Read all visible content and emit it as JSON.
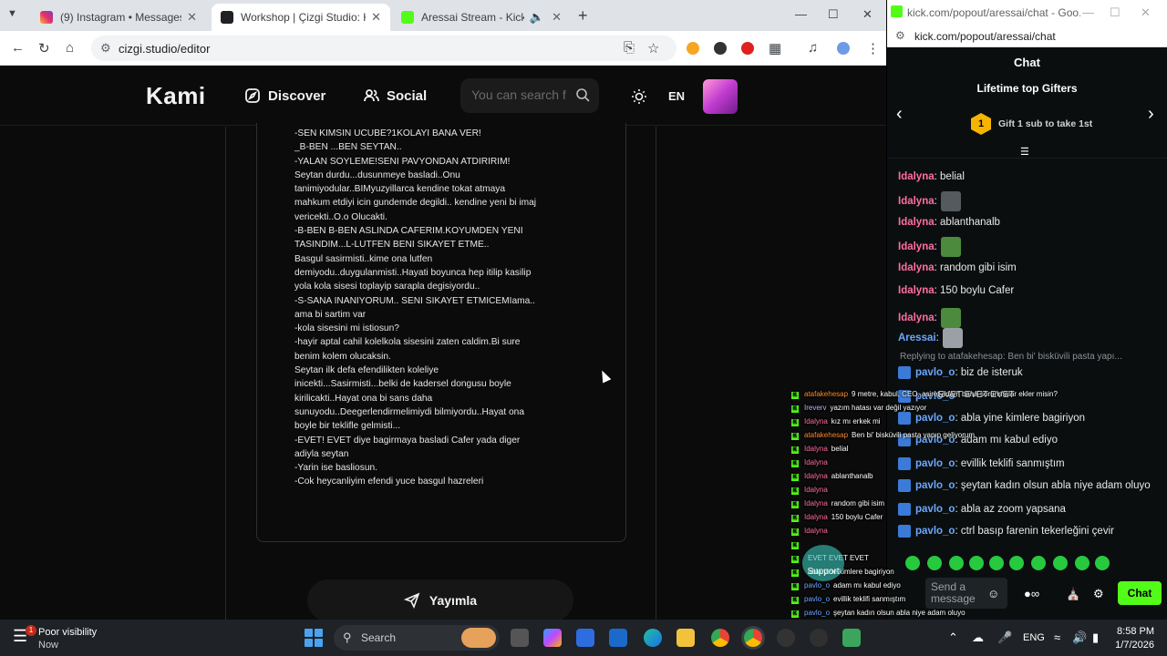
{
  "left_browser": {
    "tabs": [
      {
        "title": "(9) Instagram • Messages",
        "color": "#e1306c",
        "active": false
      },
      {
        "title": "Workshop | Çizgi Studio: Kami",
        "color": "#202124",
        "active": true
      },
      {
        "title": "Aressai Stream - Kick Dashb",
        "color": "#53fc18",
        "active": false
      }
    ],
    "url": "cizgi.studio/editor"
  },
  "site": {
    "logo": "Kami",
    "nav_discover": "Discover",
    "nav_social": "Social",
    "search_placeholder": "You can search f",
    "lang": "EN",
    "publish_label": "Yayımla",
    "story_lines": [
      "-SEN KIMSIN UCUBE?1KOLAYI BANA VER!",
      "_B-BEN ...BEN SEYTAN..",
      "-YALAN SOYLEME!SENI PAVYONDAN ATDIRIRIM!",
      "Seytan durdu...dusunmeye basladi..Onu",
      "tanimiyodular..BIMyuzyillarca kendine tokat atmaya",
      "mahkum etdiyi icin gundemde degildi.. kendine yeni bi imaj",
      "vericekti..O.o Olucakti.",
      "-B-BEN  B-BEN ASLINDA CAFERIM.KOYUMDEN YENI",
      "TASINDIM...L-LUTFEN BENI SIKAYET ETME..",
      "Basgul sasirmisti..kime ona lutfen",
      "demiyodu..duygulanmisti..Hayati boyunca hep itilip kasilip",
      "yola kola sisesi toplayip sarapla degisiyordu..",
      "-S-SANA INANIYORUM.. SENI SIKAYET ETMICEMIama..",
      "ama bi sartim var",
      "-kola sisesini mi istiosun?",
      "-hayir aptal cahil kolelkola sisesini zaten caldim.Bi sure",
      "benim kolem olucaksin.",
      "Seytan ilk defa efendilikten koleliye",
      "inicekti...Sasirmisti...belki de kadersel dongusu boyle",
      "kirilicakti..Hayat ona bi sans daha",
      "sunuyodu..Deegerlendirmelimiydi bilmiyordu..Hayat ona",
      "boyle bir teklifle gelmisti...",
      "-EVET! EVET diye bagirmaya basladi Cafer yada diger",
      "adiyla seytan",
      "-Yarin ise basliosun.",
      "-Cok heycanliyim efendi yuce basgul hazreleri"
    ]
  },
  "overlay_chat": [
    {
      "user": "atafakehesap",
      "color": "#ff8a2b",
      "text": "9 metre, kabul, CEO, asiret adam bana sorunmalar ekler misin?"
    },
    {
      "user": "Ireverv",
      "color": "#b9b9ff",
      "text": "yazım hatası var değil yazıyor"
    },
    {
      "user": "Idalyna",
      "color": "#ff6ea3",
      "text": "kız mı erkek mi"
    },
    {
      "user": "atafakehesap",
      "color": "#ff8a2b",
      "text": "Ben bi' bisküvili pasta yapıp geliyorum."
    },
    {
      "user": "Idalyna",
      "color": "#ff6ea3",
      "text": "belial"
    },
    {
      "user": "Idalyna",
      "color": "#ff6ea3",
      "text": ""
    },
    {
      "user": "Idalyna",
      "color": "#ff6ea3",
      "text": "ablanthanalb"
    },
    {
      "user": "Idalyna",
      "color": "#ff6ea3",
      "text": ""
    },
    {
      "user": "Idalyna",
      "color": "#ff6ea3",
      "text": "random gibi isim"
    },
    {
      "user": "Idalyna",
      "color": "#ff6ea3",
      "text": "150 boylu Cafer"
    },
    {
      "user": "Idalyna",
      "color": "#ff6ea3",
      "text": ""
    },
    {
      "user": "",
      "color": "#fff",
      "text": ""
    },
    {
      "user": "",
      "color": "#fff",
      "text": "EVET EVET EVET"
    },
    {
      "user": "",
      "color": "#fff",
      "text": "abla yine kimlere bagiriyon"
    },
    {
      "user": "pavlo_o",
      "color": "#6aa8ff",
      "text": "adam mı kabul ediyo"
    },
    {
      "user": "pavlo_o",
      "color": "#6aa8ff",
      "text": "evillik teklifi sanmıştım"
    },
    {
      "user": "pavlo_o",
      "color": "#6aa8ff",
      "text": "şeytan kadın olsun abla niye adam oluyo"
    },
    {
      "user": "pavlo_o",
      "color": "#6aa8ff",
      "text": "abla az zoom yapsana"
    },
    {
      "user": "pavlo_o",
      "color": "#6aa8ff",
      "text": "ctrl basıp farenin tekerleğini çevir"
    }
  ],
  "overlay_support": "Support",
  "right_browser": {
    "title": "kick.com/popout/aressai/chat - Goo...",
    "url": "kick.com/popout/aressai/chat",
    "chat_header": "Chat",
    "gifters_title": "Lifetime top Gifters",
    "gifter_rank": "1",
    "gifter_text": "Gift 1 sub to take 1st",
    "reply_text": "Replying to atafakehesap: Ben bi' bisküvili pasta yapı...",
    "overlap_text": "EVET EVET EVET",
    "composer_placeholder": "Send a message",
    "send_label": "Chat",
    "messages": [
      {
        "user": "Idalyna",
        "color": "#ff6ea3",
        "text": ": belial",
        "emote": "",
        "mod": false
      },
      {
        "user": "Idalyna",
        "color": "#ff6ea3",
        "text": ":",
        "emote": "#555a5e",
        "mod": false
      },
      {
        "user": "Idalyna",
        "color": "#ff6ea3",
        "text": ": ablanthanalb",
        "emote": "",
        "mod": false
      },
      {
        "user": "Idalyna",
        "color": "#ff6ea3",
        "text": ":",
        "emote": "#4c8a3e",
        "mod": false
      },
      {
        "user": "Idalyna",
        "color": "#ff6ea3",
        "text": ": random gibi isim",
        "emote": "",
        "mod": false
      },
      {
        "user": "Idalyna",
        "color": "#ff6ea3",
        "text": ": 150 boylu Cafer",
        "emote": "",
        "mod": false
      },
      {
        "user": "Idalyna",
        "color": "#ff6ea3",
        "text": ":",
        "emote": "#4c8a3e",
        "mod": false
      },
      {
        "user": "Aressai",
        "color": "#6aa8ff",
        "text": ":",
        "emote": "#9aa0a6",
        "mod": false
      },
      {
        "user": "pavlo_o",
        "color": "#6aa8ff",
        "text": ": biz de isteruk",
        "emote": "",
        "mod": true
      },
      {
        "user": "pavlo_o",
        "color": "#6aa8ff",
        "text": "",
        "emote": "",
        "mod": true
      },
      {
        "user": "pavlo_o",
        "color": "#6aa8ff",
        "text": ": abla yine kimlere bagiriyon",
        "emote": "",
        "mod": true
      },
      {
        "user": "pavlo_o",
        "color": "#6aa8ff",
        "text": ": adam mı kabul ediyo",
        "emote": "",
        "mod": true
      },
      {
        "user": "pavlo_o",
        "color": "#6aa8ff",
        "text": ": evillik teklifi sanmıştım",
        "emote": "",
        "mod": true
      },
      {
        "user": "pavlo_o",
        "color": "#6aa8ff",
        "text": ": şeytan kadın olsun abla niye adam oluyo",
        "emote": "",
        "mod": true
      },
      {
        "user": "pavlo_o",
        "color": "#6aa8ff",
        "text": ": abla az zoom yapsana",
        "emote": "",
        "mod": true
      },
      {
        "user": "pavlo_o",
        "color": "#6aa8ff",
        "text": ": ctrl basıp farenin tekerleğini çevir",
        "emote": "",
        "mod": true
      }
    ]
  },
  "taskbar": {
    "weather_line1": "Poor visibility",
    "weather_line2": "Now",
    "weather_badge": "1",
    "search_label": "Search",
    "lang": "ENG",
    "time": "8:58 PM",
    "date": "1/7/2026"
  }
}
